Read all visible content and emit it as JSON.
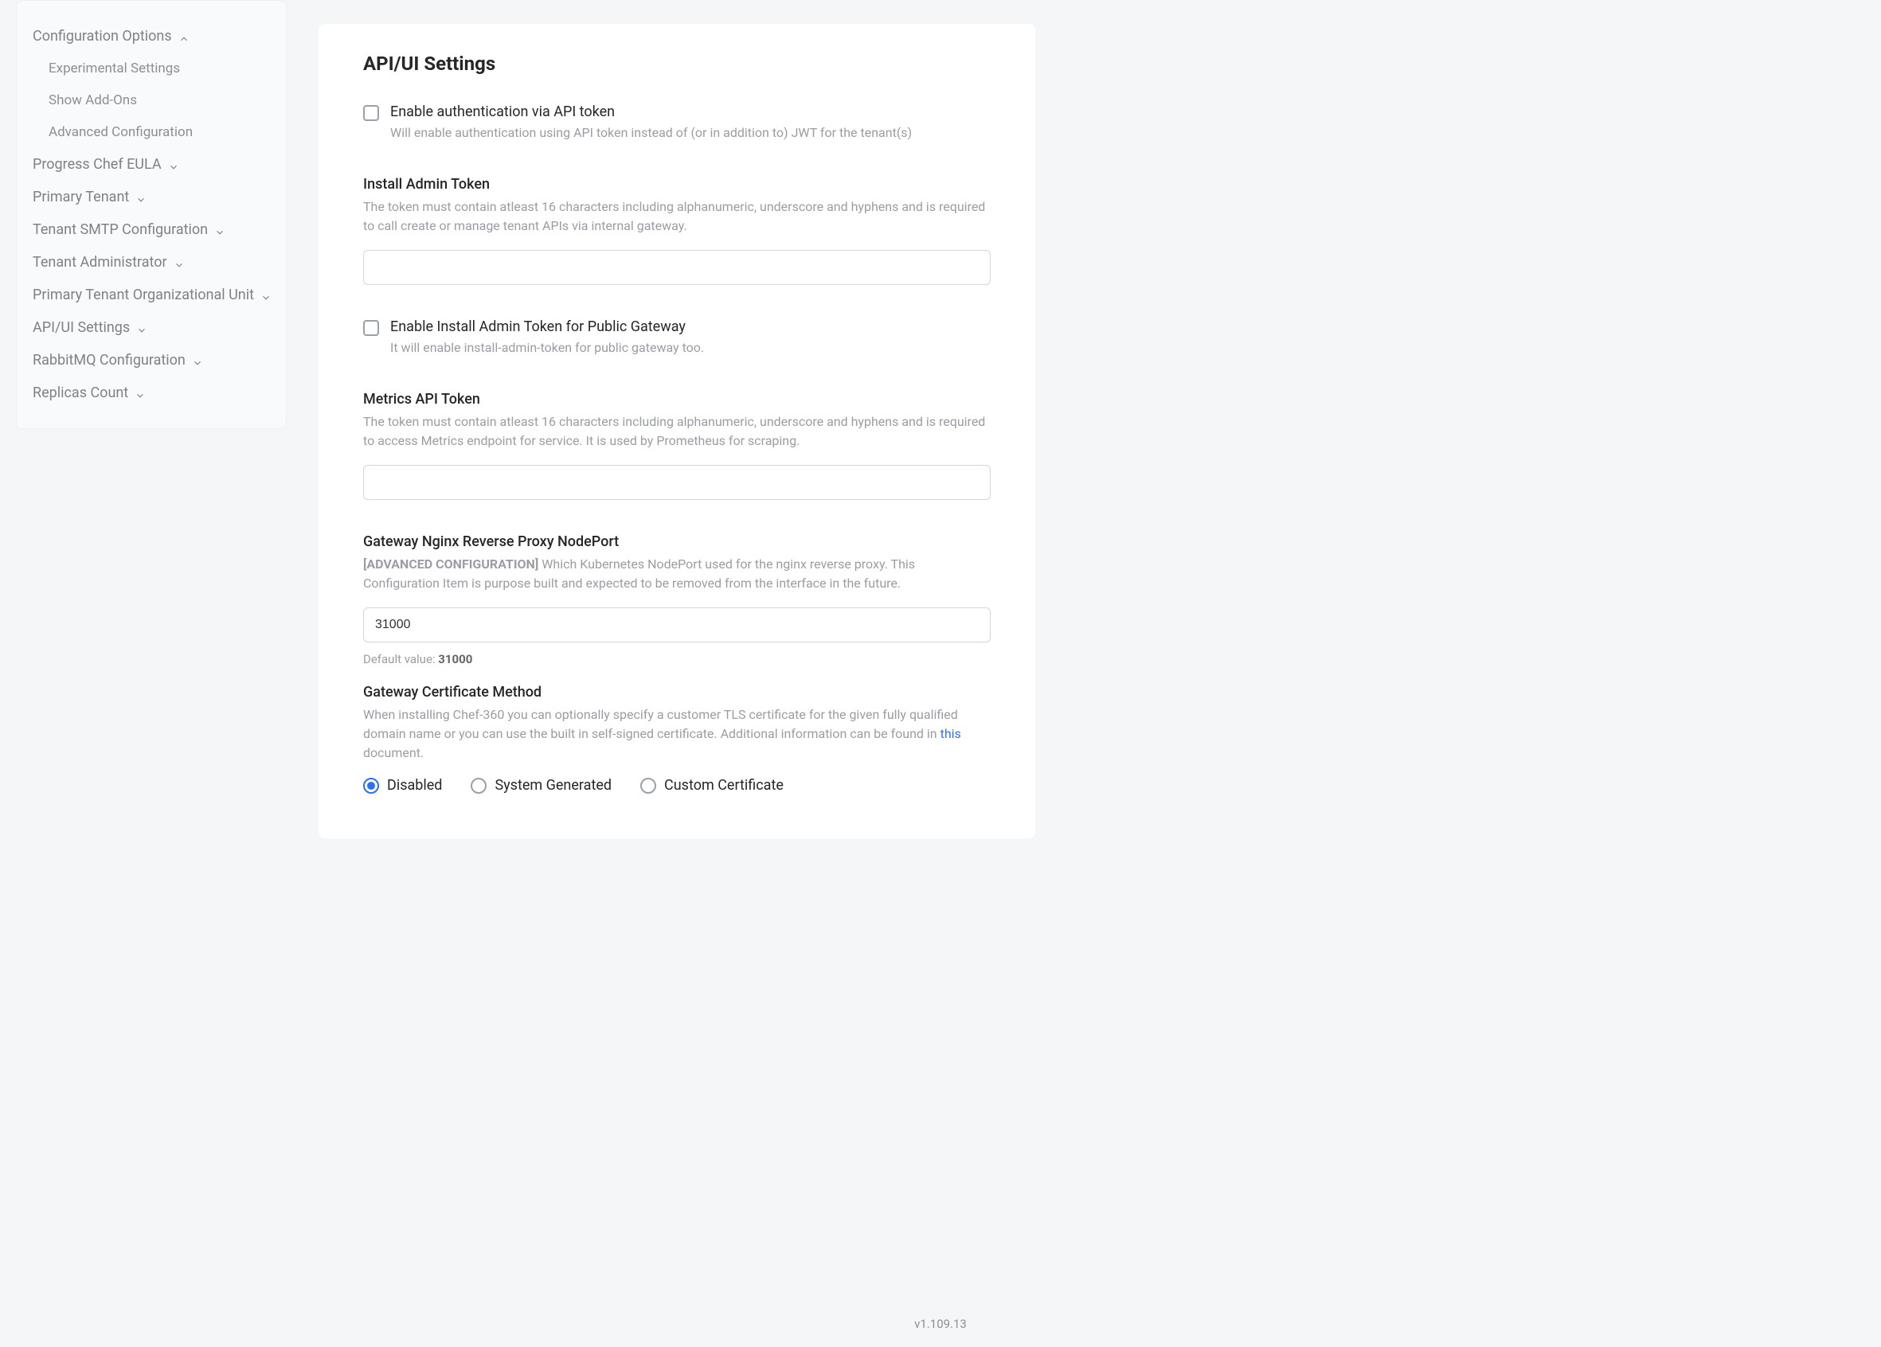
{
  "sidebar": {
    "groups": [
      {
        "label": "Configuration Options",
        "expanded": true,
        "children": [
          {
            "label": "Experimental Settings"
          },
          {
            "label": "Show Add-Ons"
          },
          {
            "label": "Advanced Configuration"
          }
        ]
      },
      {
        "label": "Progress Chef EULA",
        "expanded": false
      },
      {
        "label": "Primary Tenant",
        "expanded": false
      },
      {
        "label": "Tenant SMTP Configuration",
        "expanded": false
      },
      {
        "label": "Tenant Administrator",
        "expanded": false
      },
      {
        "label": "Primary Tenant Organizational Unit",
        "expanded": false
      },
      {
        "label": "API/UI Settings",
        "expanded": false
      },
      {
        "label": "RabbitMQ Configuration",
        "expanded": false
      },
      {
        "label": "Replicas Count",
        "expanded": false
      }
    ]
  },
  "panel": {
    "title": "API/UI Settings",
    "enableAuth": {
      "label": "Enable authentication via API token",
      "desc": "Will enable authentication using API token instead of (or in addition to) JWT for the tenant(s)",
      "checked": false
    },
    "installToken": {
      "label": "Install Admin Token",
      "desc": "The token must contain atleast 16 characters including alphanumeric, underscore and hyphens and is required to call create or manage tenant APIs via internal gateway.",
      "value": ""
    },
    "enablePublic": {
      "label": "Enable Install Admin Token for Public Gateway",
      "desc": "It will enable install-admin-token for public gateway too.",
      "checked": false
    },
    "metricsToken": {
      "label": "Metrics API Token",
      "desc": "The token must contain atleast 16 characters including alphanumeric, underscore and hyphens and is required to access Metrics endpoint for service. It is used by Prometheus for scraping.",
      "value": ""
    },
    "gatewayPort": {
      "label": "Gateway Nginx Reverse Proxy NodePort",
      "prefix": "[ADVANCED CONFIGURATION]",
      "desc": " Which Kubernetes NodePort used for the nginx reverse proxy. This Configuration Item is purpose built and expected to be removed from the interface in the future.",
      "value": "31000",
      "defaultLabel": "Default value: ",
      "defaultValue": "31000"
    },
    "certMethod": {
      "label": "Gateway Certificate Method",
      "descPre": "When installing Chef-360 you can optionally specify a customer TLS certificate for the given fully qualified domain name or you can use the built in self-signed certificate. Additional information can be found in ",
      "linkText": "this",
      "descPost": " document.",
      "options": [
        {
          "label": "Disabled",
          "selected": true
        },
        {
          "label": "System Generated",
          "selected": false
        },
        {
          "label": "Custom Certificate",
          "selected": false
        }
      ]
    }
  },
  "footer": {
    "version": "v1.109.13"
  }
}
